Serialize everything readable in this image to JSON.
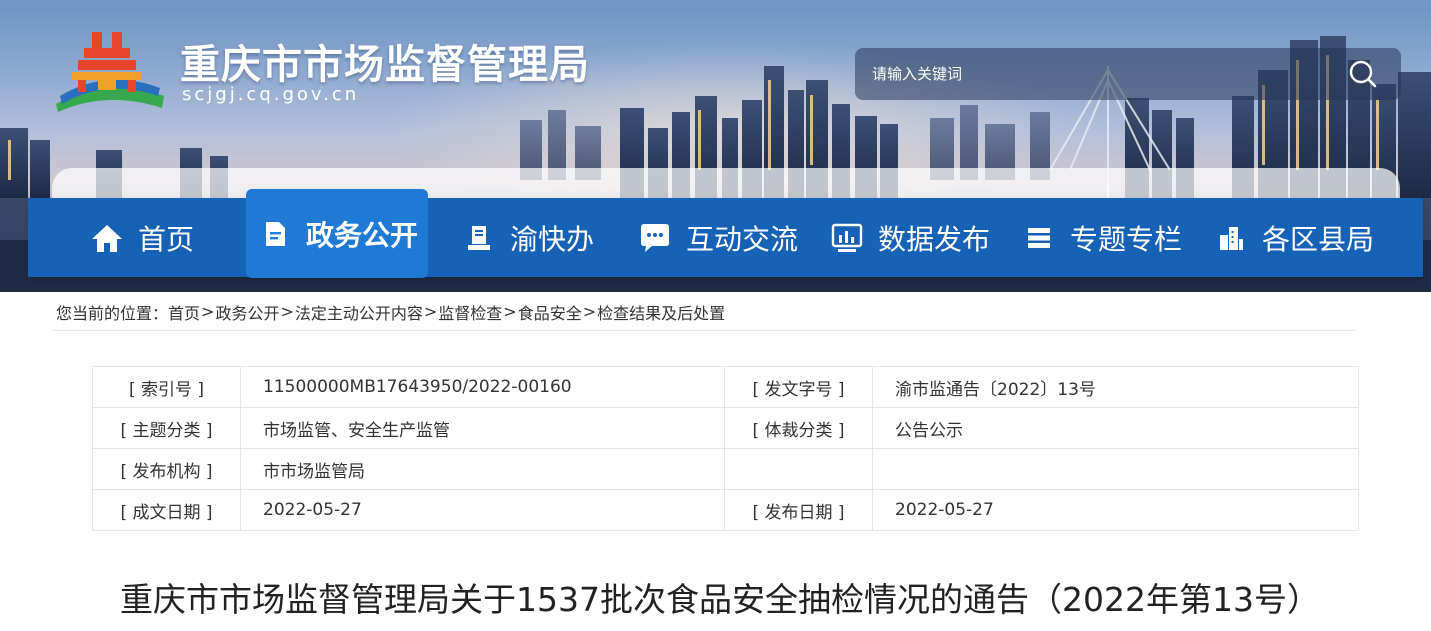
{
  "header": {
    "site_title": "重庆市市场监督管理局",
    "site_domain": "scjgj.cq.gov.cn",
    "logo_icon": "municipal-emblem-icon",
    "search": {
      "placeholder": "请输入关键词",
      "icon": "search-icon"
    }
  },
  "nav": {
    "items": [
      {
        "label": "首页",
        "icon": "home-icon"
      },
      {
        "label": "政务公开",
        "icon": "document-icon",
        "active": true
      },
      {
        "label": "渝快办",
        "icon": "service-desk-icon"
      },
      {
        "label": "互动交流",
        "icon": "chat-icon"
      },
      {
        "label": "数据发布",
        "icon": "bar-chart-icon"
      },
      {
        "label": "专题专栏",
        "icon": "stack-icon"
      },
      {
        "label": "各区县局",
        "icon": "buildings-icon"
      }
    ],
    "active_color": "#1f7ad6",
    "bar_color": "#1761b6"
  },
  "breadcrumb": {
    "prefix": "您当前的位置：",
    "items": [
      "首页",
      "政务公开",
      "法定主动公开内容",
      "监督检查",
      "食品安全",
      "检查结果及后处置"
    ],
    "separator": ">"
  },
  "meta": {
    "rows": [
      {
        "k1": "[ 索引号 ]",
        "v1": "11500000MB17643950/2022-00160",
        "k2": "[ 发文字号 ]",
        "v2": "渝市监通告〔2022〕13号"
      },
      {
        "k1": "[ 主题分类 ]",
        "v1": "市场监管、安全生产监管",
        "k2": "[ 体裁分类 ]",
        "v2": "公告公示"
      },
      {
        "k1": "[ 发布机构 ]",
        "v1": "市市场监管局",
        "k2": "",
        "v2": ""
      },
      {
        "k1": "[ 成文日期 ]",
        "v1": "2022-05-27",
        "k2": "[ 发布日期 ]",
        "v2": "2022-05-27"
      }
    ]
  },
  "article": {
    "title": "重庆市市场监督管理局关于1537批次食品安全抽检情况的通告（2022年第13号）"
  }
}
